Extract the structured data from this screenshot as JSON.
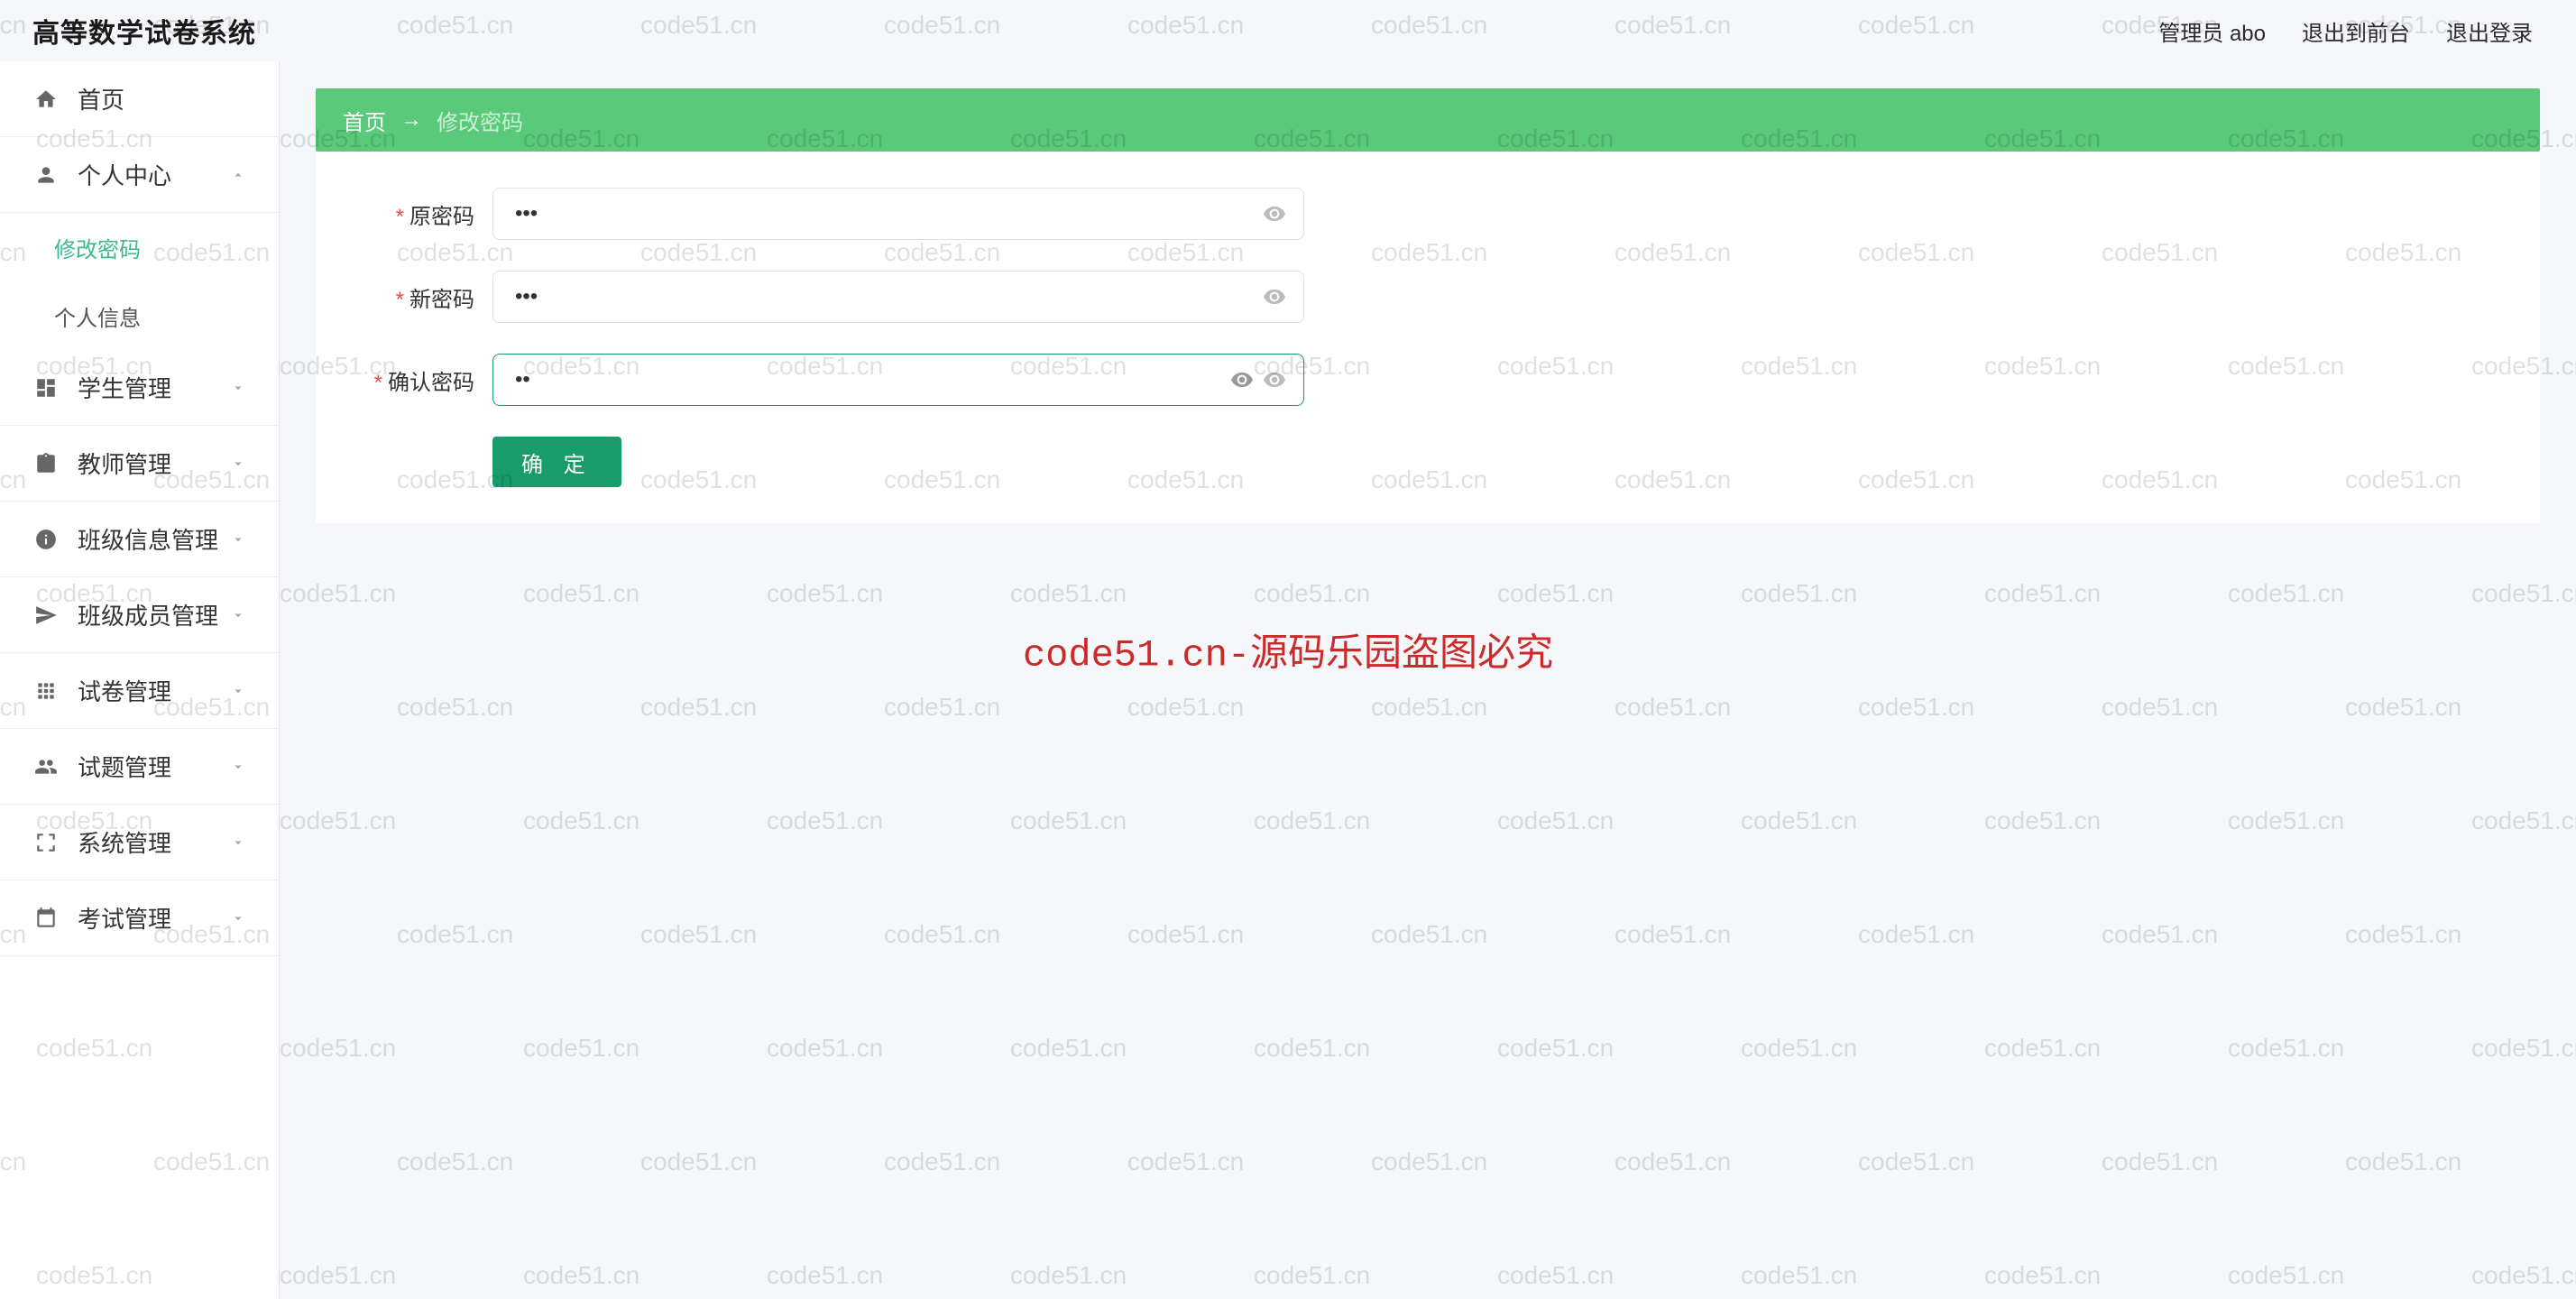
{
  "header": {
    "title": "高等数学试卷系统",
    "admin_label": "管理员 abo",
    "exit_front_label": "退出到前台",
    "logout_label": "退出登录"
  },
  "sidebar": {
    "home": "首页",
    "personal_center": "个人中心",
    "change_password": "修改密码",
    "personal_info": "个人信息",
    "student_mgmt": "学生管理",
    "teacher_mgmt": "教师管理",
    "class_info_mgmt": "班级信息管理",
    "class_member_mgmt": "班级成员管理",
    "exam_paper_mgmt": "试卷管理",
    "question_mgmt": "试题管理",
    "system_mgmt": "系统管理",
    "exam_mgmt": "考试管理"
  },
  "breadcrumb": {
    "home": "首页",
    "current": "修改密码"
  },
  "form": {
    "old_password_label": "原密码",
    "new_password_label": "新密码",
    "confirm_password_label": "确认密码",
    "old_password_value": "•••",
    "new_password_value": "•••",
    "confirm_password_value": "••",
    "submit_label": "确 定"
  },
  "watermark": {
    "text": "code51.cn",
    "center_text": "code51.cn-源码乐园盗图必究"
  }
}
